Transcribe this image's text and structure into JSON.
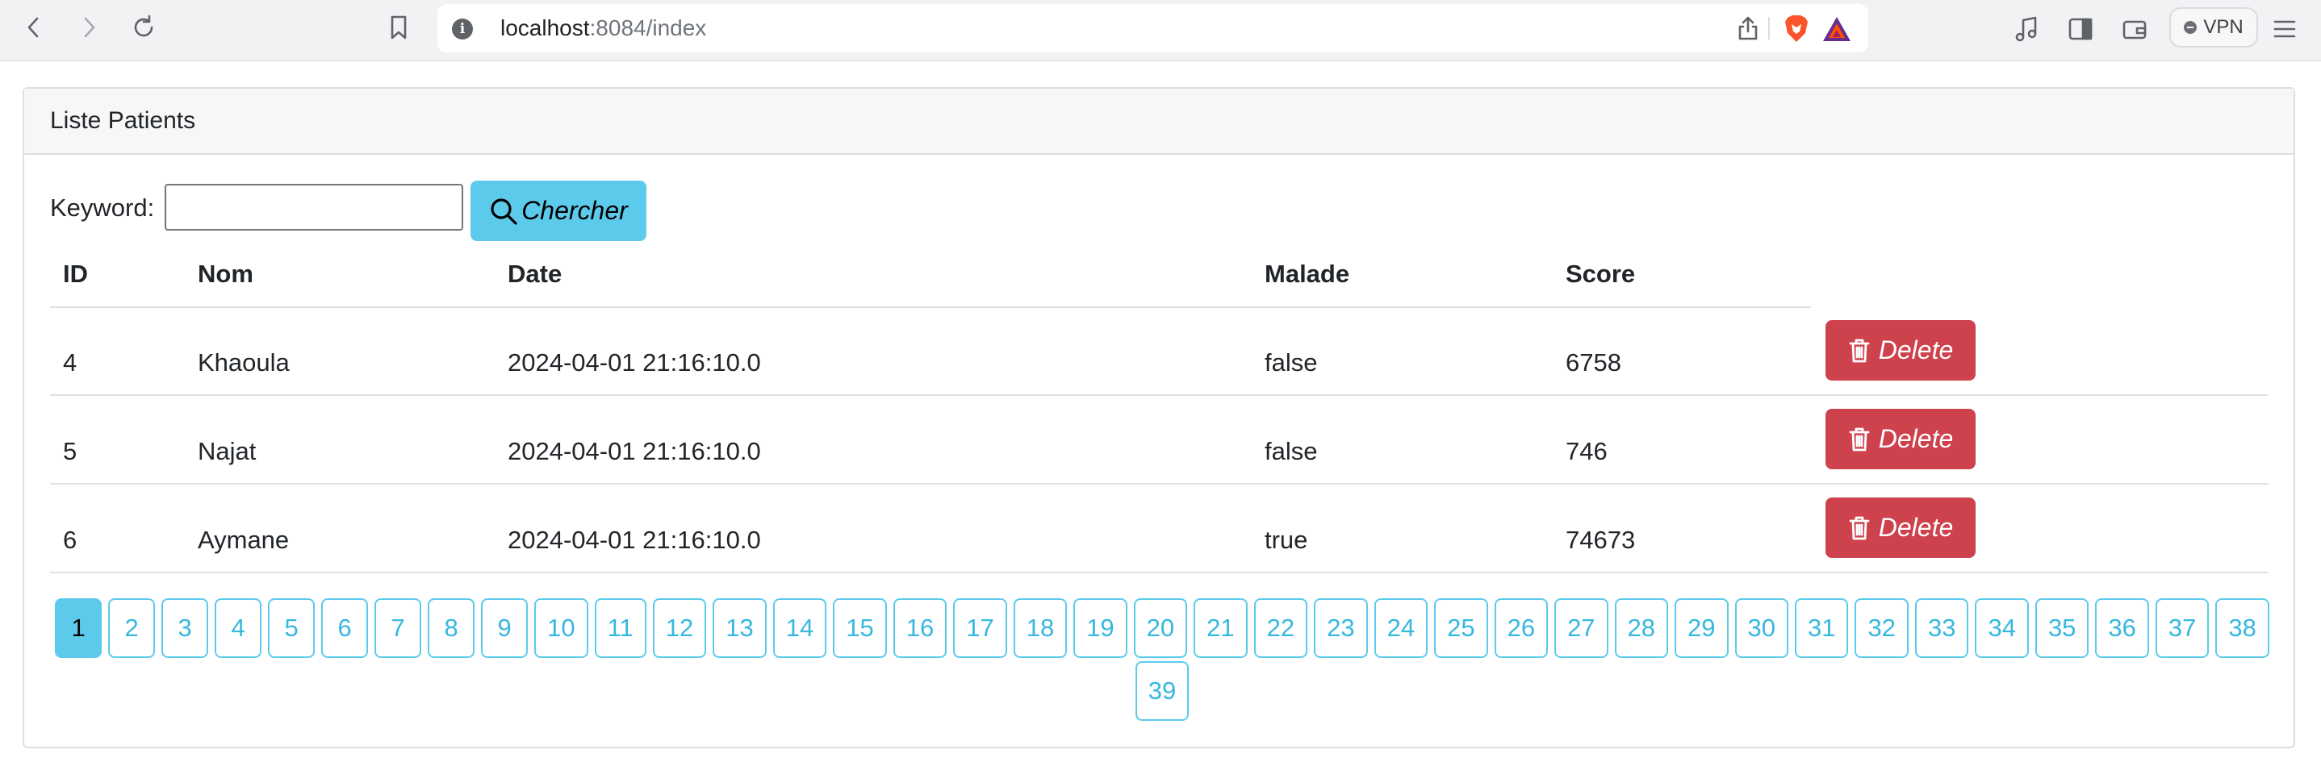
{
  "browser": {
    "url_host": "localhost",
    "url_path": ":8084/index",
    "vpn_label": "VPN"
  },
  "card": {
    "title": "Liste Patients"
  },
  "search": {
    "label": "Keyword:",
    "value": "",
    "button_label": "Chercher"
  },
  "table": {
    "headers": {
      "id": "ID",
      "nom": "Nom",
      "date": "Date",
      "malade": "Malade",
      "score": "Score"
    },
    "rows": [
      {
        "id": "4",
        "nom": "Khaoula",
        "date": "2024-04-01 21:16:10.0",
        "malade": "false",
        "score": "6758",
        "action": "Delete"
      },
      {
        "id": "5",
        "nom": "Najat",
        "date": "2024-04-01 21:16:10.0",
        "malade": "false",
        "score": "746",
        "action": "Delete"
      },
      {
        "id": "6",
        "nom": "Aymane",
        "date": "2024-04-01 21:16:10.0",
        "malade": "true",
        "score": "74673",
        "action": "Delete"
      }
    ]
  },
  "pagination": {
    "current": "1",
    "pages": [
      "1",
      "2",
      "3",
      "4",
      "5",
      "6",
      "7",
      "8",
      "9",
      "10",
      "11",
      "12",
      "13",
      "14",
      "15",
      "16",
      "17",
      "18",
      "19",
      "20",
      "21",
      "22",
      "23",
      "24",
      "25",
      "26",
      "27",
      "28",
      "29",
      "30",
      "31",
      "32",
      "33",
      "34",
      "35",
      "36",
      "37",
      "38",
      "39"
    ]
  },
  "colors": {
    "info": "#5ccbeb",
    "danger": "#ce424d"
  },
  "icons": {
    "back": "chevron-left-icon",
    "forward": "chevron-right-icon",
    "reload": "reload-icon",
    "bookmark": "bookmark-icon",
    "site_info": "info-icon",
    "share": "share-icon",
    "brave": "brave-shield-icon",
    "rewards": "bat-rewards-icon",
    "media": "music-note-icon",
    "sidebar": "sidebar-icon",
    "wallet": "wallet-icon",
    "menu": "hamburger-menu-icon",
    "search": "search-icon",
    "delete": "trash-icon"
  }
}
